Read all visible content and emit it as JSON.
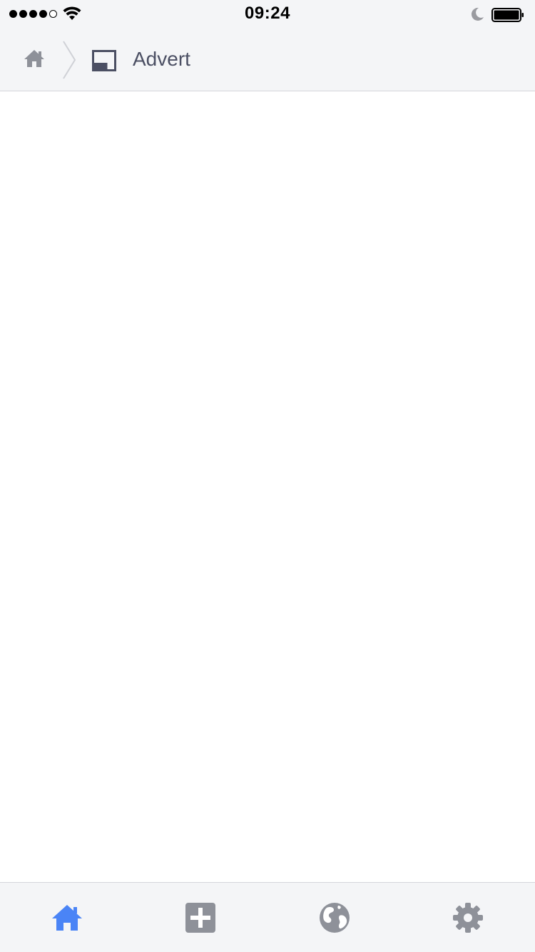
{
  "status_bar": {
    "time": "09:24",
    "signal_bars_filled": 4,
    "signal_bars_total": 5,
    "icons": [
      "wifi-icon",
      "moon-icon",
      "battery-icon"
    ]
  },
  "breadcrumb": {
    "home_icon": "home-icon",
    "separator_icon": "chevron-right-icon",
    "page_icon": "advert-layout-icon",
    "current_label": "Advert"
  },
  "tab_bar": {
    "tabs": [
      {
        "icon": "home-icon",
        "active": true
      },
      {
        "icon": "add-square-icon",
        "active": false
      },
      {
        "icon": "globe-icon",
        "active": false
      },
      {
        "icon": "gear-icon",
        "active": false
      }
    ]
  },
  "colors": {
    "active_tab": "#4a84f6",
    "inactive_tab": "#8e9199",
    "bar_background": "#f4f5f7",
    "label_text": "#4b4f63"
  }
}
